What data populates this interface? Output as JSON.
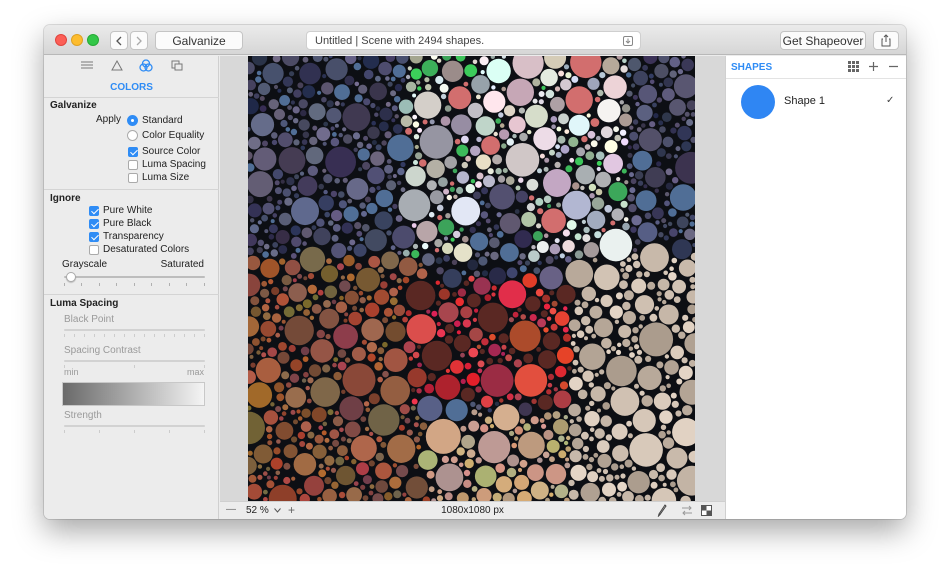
{
  "colors": {
    "accent": "#2f8cf5",
    "close": "#fc5f57",
    "minimize": "#fdbc2e",
    "zoom": "#33c748",
    "shape_swatch": "#2f86f3"
  },
  "toolbar": {
    "back_icon": "chevron-left-icon",
    "forward_icon": "chevron-right-icon",
    "galvanize_button": "Galvanize",
    "document_title": "Untitled | Scene with 2494 shapes.",
    "get_shapeover_button": "Get Shapeover",
    "share_icon": "share-icon"
  },
  "left_panel": {
    "tabs": [
      "list-icon",
      "triangle-icon",
      "colors-icon",
      "copy-icon"
    ],
    "section_header": "COLORS",
    "galvanize": {
      "title": "Galvanize",
      "apply_label": "Apply",
      "radios": [
        {
          "label": "Standard",
          "selected": true
        },
        {
          "label": "Color Equality",
          "selected": false
        }
      ],
      "checkboxes": [
        {
          "label": "Source Color",
          "checked": true
        },
        {
          "label": "Luma Spacing",
          "checked": false
        },
        {
          "label": "Luma Size",
          "checked": false
        }
      ]
    },
    "ignore": {
      "title": "Ignore",
      "checkboxes": [
        {
          "label": "Pure White",
          "checked": true
        },
        {
          "label": "Pure Black",
          "checked": true
        },
        {
          "label": "Transparency",
          "checked": true
        },
        {
          "label": "Desaturated Colors",
          "checked": false
        }
      ],
      "slider_min_label": "Grayscale",
      "slider_max_label": "Saturated"
    },
    "luma_spacing": {
      "title": "Luma Spacing",
      "black_point_label": "Black Point",
      "spacing_contrast_label": "Spacing Contrast",
      "min_label": "min",
      "max_label": "max",
      "strength_label": "Strength"
    }
  },
  "canvas": {
    "zoom_minus": "—",
    "zoom_level": "52 %",
    "zoom_plus": "+",
    "dimensions": "1080x1080 px"
  },
  "right_panel": {
    "header": "SHAPES",
    "shapes": [
      {
        "name": "Shape 1",
        "checked": true,
        "check_glyph": "✓"
      }
    ]
  }
}
